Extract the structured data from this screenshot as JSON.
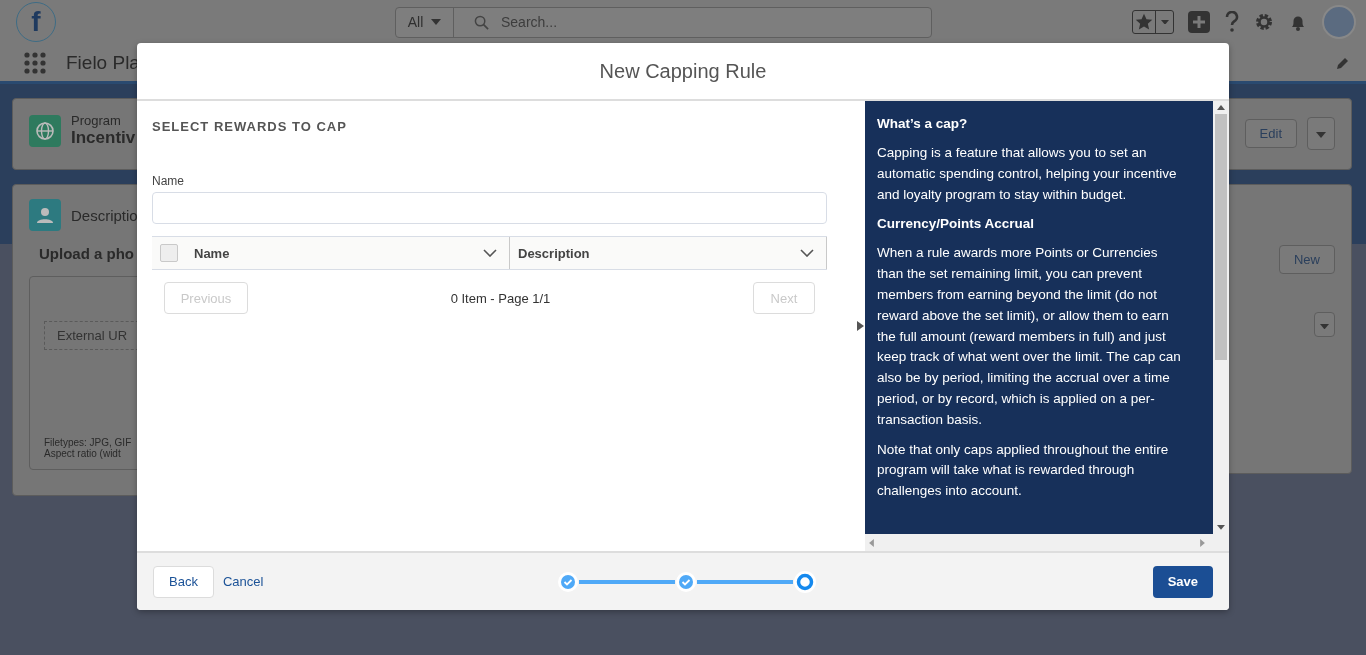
{
  "header": {
    "logo_letter": "f",
    "search_scope": "All",
    "search_placeholder": "Search..."
  },
  "nav": {
    "app_name": "Fielo Pla"
  },
  "record": {
    "object": "Program",
    "name": "Incentiv",
    "edit": "Edit"
  },
  "description_card": {
    "title": "Descriptio",
    "upload_title": "Upload a pho",
    "external_url": "External UR",
    "filetypes": "Filetypes: JPG, GIF",
    "aspect": "Aspect ratio (widt"
  },
  "related_card": {
    "new": "New"
  },
  "modal": {
    "title": "New Capping Rule",
    "section": "SELECT REWARDS TO CAP",
    "name_label": "Name",
    "table": {
      "select_all_checked": false,
      "columns": [
        {
          "label": "Name"
        },
        {
          "label": "Description"
        }
      ]
    },
    "pager": {
      "previous": "Previous",
      "previous_disabled": true,
      "status": "0 Item - Page 1/1",
      "next": "Next",
      "next_disabled": true
    },
    "help": [
      {
        "kind": "heading",
        "text": "What’s a cap?"
      },
      {
        "kind": "paragraph",
        "text": "Capping is a feature that allows you to set an automatic spending control, helping your incentive and loyalty program to stay within budget."
      },
      {
        "kind": "heading",
        "text": "Currency/Points Accrual"
      },
      {
        "kind": "paragraph",
        "text": "When a rule awards more Points or Currencies than the set remaining limit, you can prevent members from earning beyond the limit (do not reward above the set limit), or allow them to earn the full amount (reward members in full) and just keep track of what went over the limit. The cap can also be by period, limiting the accrual over a time period, or by record, which is applied on a per-transaction basis."
      },
      {
        "kind": "paragraph",
        "text": "Note that only caps applied throughout the entire program will take what is rewarded through challenges into account."
      }
    ],
    "steps": [
      {
        "completed": true,
        "selected": false
      },
      {
        "completed": true,
        "selected": false
      },
      {
        "completed": false,
        "selected": true
      }
    ],
    "footer": {
      "back": "Back",
      "cancel": "Cancel",
      "save": "Save"
    }
  }
}
